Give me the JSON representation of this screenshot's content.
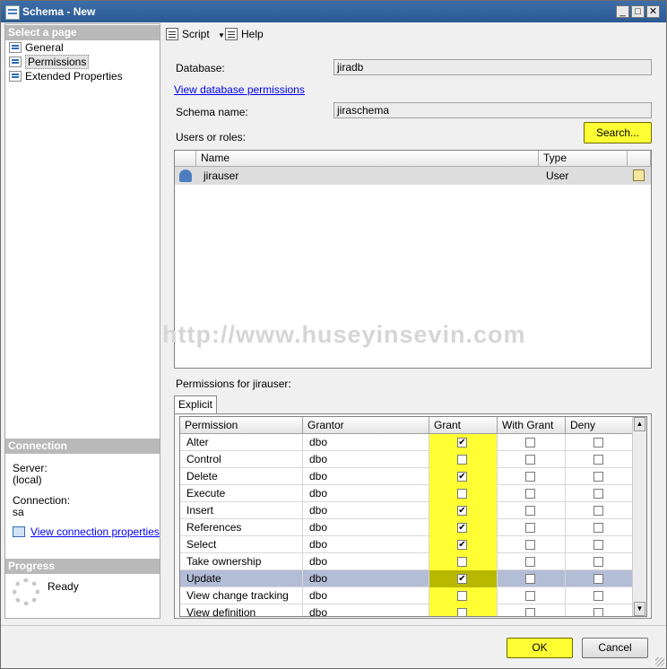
{
  "window": {
    "title": "Schema - New"
  },
  "left": {
    "select_page_header": "Select a page",
    "pages": [
      {
        "label": "General",
        "selected": false
      },
      {
        "label": "Permissions",
        "selected": true
      },
      {
        "label": "Extended Properties",
        "selected": false
      }
    ],
    "connection_header": "Connection",
    "server_label": "Server:",
    "server_value": "(local)",
    "connection_label": "Connection:",
    "connection_value": "sa",
    "view_connection_link": "View connection properties",
    "progress_header": "Progress",
    "progress_status": "Ready"
  },
  "toolbar": {
    "script_label": "Script",
    "help_label": "Help"
  },
  "main": {
    "database_label": "Database:",
    "database_value": "jiradb",
    "view_db_permissions_link": "View database permissions",
    "schema_name_label": "Schema name:",
    "schema_name_value": "jiraschema",
    "users_roles_label": "Users or roles:",
    "search_button": "Search...",
    "users_table": {
      "headers": [
        "Name",
        "Type"
      ],
      "rows": [
        {
          "name": "jirauser",
          "type": "User"
        }
      ]
    },
    "permissions_for_label": "Permissions for jirauser:",
    "tab_explicit": "Explicit",
    "permissions_table": {
      "headers": [
        "Permission",
        "Grantor",
        "Grant",
        "With Grant",
        "Deny"
      ],
      "rows": [
        {
          "permission": "Alter",
          "grantor": "dbo",
          "grant": true,
          "with_grant": false,
          "deny": false
        },
        {
          "permission": "Control",
          "grantor": "dbo",
          "grant": false,
          "with_grant": false,
          "deny": false
        },
        {
          "permission": "Delete",
          "grantor": "dbo",
          "grant": true,
          "with_grant": false,
          "deny": false
        },
        {
          "permission": "Execute",
          "grantor": "dbo",
          "grant": false,
          "with_grant": false,
          "deny": false
        },
        {
          "permission": "Insert",
          "grantor": "dbo",
          "grant": true,
          "with_grant": false,
          "deny": false
        },
        {
          "permission": "References",
          "grantor": "dbo",
          "grant": true,
          "with_grant": false,
          "deny": false
        },
        {
          "permission": "Select",
          "grantor": "dbo",
          "grant": true,
          "with_grant": false,
          "deny": false
        },
        {
          "permission": "Take ownership",
          "grantor": "dbo",
          "grant": false,
          "with_grant": false,
          "deny": false
        },
        {
          "permission": "Update",
          "grantor": "dbo",
          "grant": true,
          "with_grant": false,
          "deny": false,
          "selected": true
        },
        {
          "permission": "View change tracking",
          "grantor": "dbo",
          "grant": false,
          "with_grant": false,
          "deny": false
        },
        {
          "permission": "View definition",
          "grantor": "dbo",
          "grant": false,
          "with_grant": false,
          "deny": false
        }
      ]
    }
  },
  "watermark": "http://www.huseyinsevin.com",
  "footer": {
    "ok_button": "OK",
    "cancel_button": "Cancel"
  },
  "colors": {
    "highlight": "#ffff33",
    "titlebar": "#2b5a93",
    "link": "#0000ee"
  }
}
